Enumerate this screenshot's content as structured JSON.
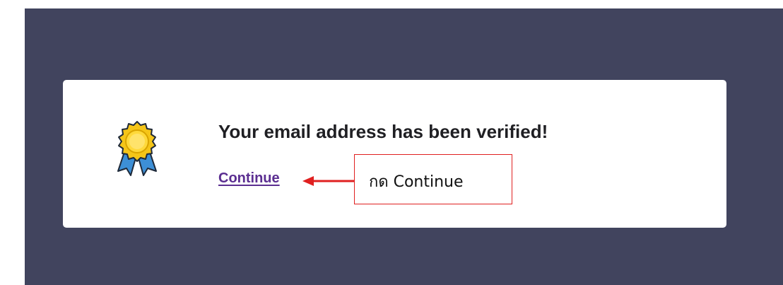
{
  "verification": {
    "message": "Your email address has been verified!",
    "continue_label": "Continue"
  },
  "badge_icon": "award-ribbon-icon",
  "annotation": {
    "text": "กด Continue",
    "color": "#e02020"
  },
  "colors": {
    "backdrop": "#41445e",
    "card": "#ffffff",
    "link": "#5b2e91",
    "badge_gold": "#f5c518",
    "badge_ribbon": "#3d8fd6"
  }
}
